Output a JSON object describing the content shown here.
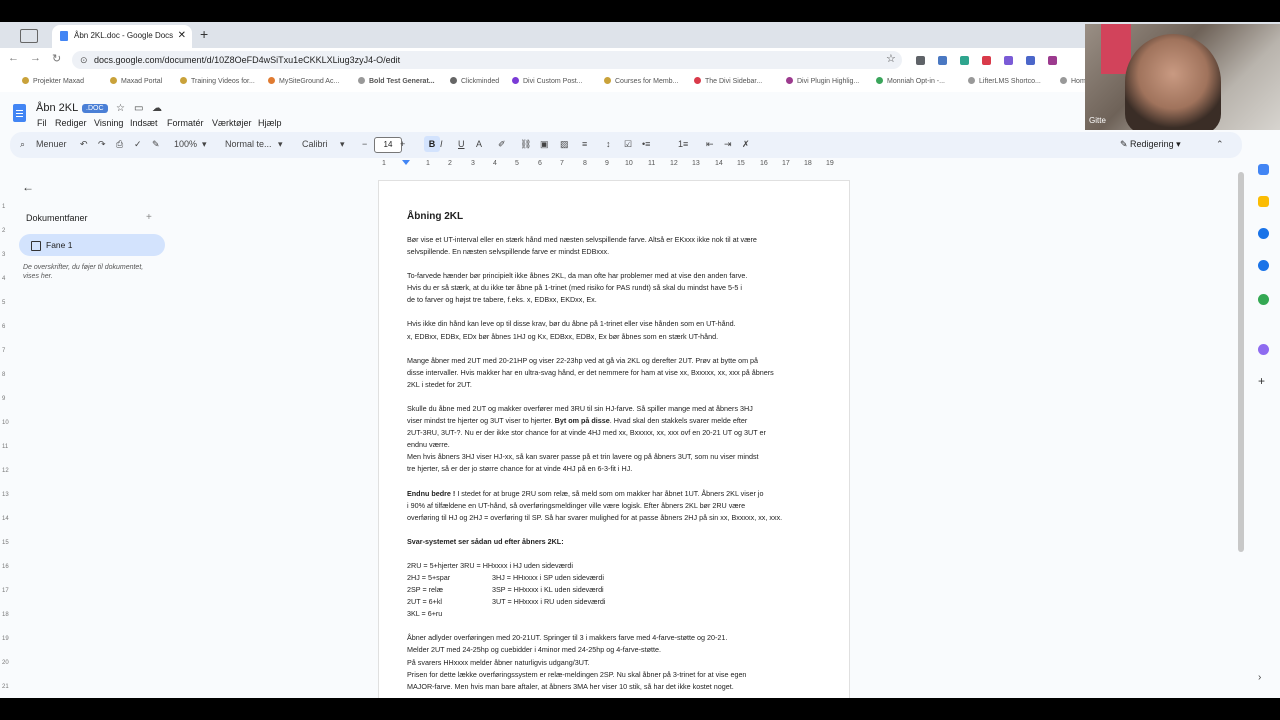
{
  "browser": {
    "tab_title": "Åbn 2KL.doc - Google Docs",
    "url": "docs.google.com/document/d/10Z8OeFD4wSiTxu1eCKKLXLiug3zyJ4-O/edit",
    "bookmarks": [
      "Projekter Maxad",
      "Maxad Portal",
      "Training Videos for...",
      "MySiteGround Ac...",
      "Bold Test Generat...",
      "Clickminded",
      "Divi Custom Post...",
      "Courses for Memb...",
      "The Divi Sidebar...",
      "Divi Plugin Highlig...",
      "Monniah Opt-in -...",
      "LifterLMS Shortco...",
      "Hom"
    ]
  },
  "docs": {
    "title": "Åbn 2KL",
    "badge": ".DOC",
    "menu": [
      "Fil",
      "Rediger",
      "Visning",
      "Indsæt",
      "Formatér",
      "Værktøjer",
      "Hjælp"
    ],
    "toolbar": {
      "search": "Menuer",
      "zoom": "100%",
      "style": "Normal te...",
      "font": "Calibri",
      "font_size": "14",
      "mode": "Redigering"
    },
    "ruler": [
      "1",
      "1",
      "2",
      "3",
      "4",
      "5",
      "6",
      "7",
      "8",
      "9",
      "10",
      "11",
      "12",
      "13",
      "14",
      "15",
      "16",
      "17",
      "18",
      "19"
    ],
    "vruler": [
      "1",
      "2",
      "3",
      "4",
      "5",
      "6",
      "7",
      "8",
      "9",
      "10",
      "11",
      "12",
      "13",
      "14",
      "15",
      "16",
      "17",
      "18",
      "19",
      "20",
      "21"
    ]
  },
  "sidebar": {
    "heading": "Dokumentfaner",
    "tab_label": "Fane 1",
    "hint": "De overskrifter, du føjer til dokumentet, vises her."
  },
  "document": {
    "heading": "Åbning 2KL",
    "p1": "Bør vise et UT-interval eller en stærk hånd med næsten selvspillende farve. Altså er EKxxx ikke nok til at være\nselvspillende. En næsten selvspillende farve er mindst EDBxxx.",
    "p2": "To-farvede hænder bør principielt ikke åbnes 2KL, da man ofte har problemer med at vise den anden farve.\nHvis du er så stærk, at du ikke tør åbne på 1-trinet (med risiko for PAS rundt) så skal du mindst have 5-5 i\nde to farver og højst tre tabere, f.eks. x, EDBxx, EKDxx, Ex.",
    "p3": "Hvis ikke din hånd kan leve op til disse krav, bør du åbne på 1-trinet eller vise hånden som en UT-hånd.\nx, EDBxx, EDBx, EDx bør åbnes 1HJ og Kx, EDBxx, EDBx, Ex bør åbnes som en stærk UT-hånd.",
    "p4": "Mange åbner med 2UT med 20-21HP og viser 22-23hp ved at gå via 2KL og derefter 2UT. Prøv at bytte om på\ndisse intervaller. Hvis makker har en ultra-svag hånd, er det nemmere for ham at vise xx, Bxxxxx, xx, xxx på åbners\n2KL i stedet for 2UT.",
    "p5a": "Skulle du åbne med 2UT og makker overfører med 3RU til sin HJ-farve. Så spiller mange med at åbners 3HJ\nviser mindst tre hjerter og 3UT viser to hjerter. ",
    "p5b": "Byt om på disse",
    "p5c": ". Hvad skal den stakkels svarer melde efter\n2UT-3RU, 3UT-?. Nu er der ikke stor chance for at vinde 4HJ med xx, Bxxxxx, xx, xxx ovf en 20-21 UT og 3UT er\nendnu værre.\nMen hvis åbners 3HJ viser HJ-xx, så kan svarer passe på et trin lavere og på åbners 3UT, som nu viser mindst\ntre hjerter, så er der jo større chance for at vinde 4HJ på en 6-3-fit i HJ.",
    "p6a": "Endnu bedre ! ",
    "p6b": "I stedet for at bruge 2RU som relæ, så meld som om makker har åbnet 1UT. Åbners 2KL viser jo\ni 90% af tilfældene en UT-hånd, så overføringsmeldinger ville være logisk. Efter åbners 2KL bør 2RU være\noverføring til HJ og 2HJ = overføring til SP. Så har svarer mulighed for at passe åbners 2HJ på sin xx, Bxxxxx, xx, xxx.",
    "svar_heading": "Svar-systemet ser sådan ud efter åbners 2KL:",
    "svar_rows": [
      [
        "2RU = 5+hjerter 3RU = HHxxxx i HJ uden sideværdi",
        ""
      ],
      [
        "2HJ =  5+spar",
        "3HJ =  HHxxxx i SP uden sideværdi"
      ],
      [
        "2SP =  relæ",
        "3SP =  HHxxxx i KL uden sideværdi"
      ],
      [
        "2UT = 6+kl",
        "3UT = HHxxxx i RU uden sideværdi"
      ],
      [
        "3KL =  6+ru",
        ""
      ]
    ],
    "p7": "Åbner adlyder overføringen med 20-21UT. Springer til 3 i makkers farve med 4-farve-støtte og 20-21.\nMelder 2UT med 24-25hp og cuebidder i 4minor med 24-25hp og 4-farve-støtte.\nPå svarers HHxxxx melder åbner naturligvis udgang/3UT.\nPrisen for dette lække overføringssystem er relæ-meldingen 2SP. Nu skal åbner på 3-trinet for at vise egen\nMAJOR-farve.    Men hvis man bare aftaler, at åbners 3MA her viser 10 stik, så har det ikke kostet noget."
  },
  "video": {
    "name": "Gitte"
  }
}
